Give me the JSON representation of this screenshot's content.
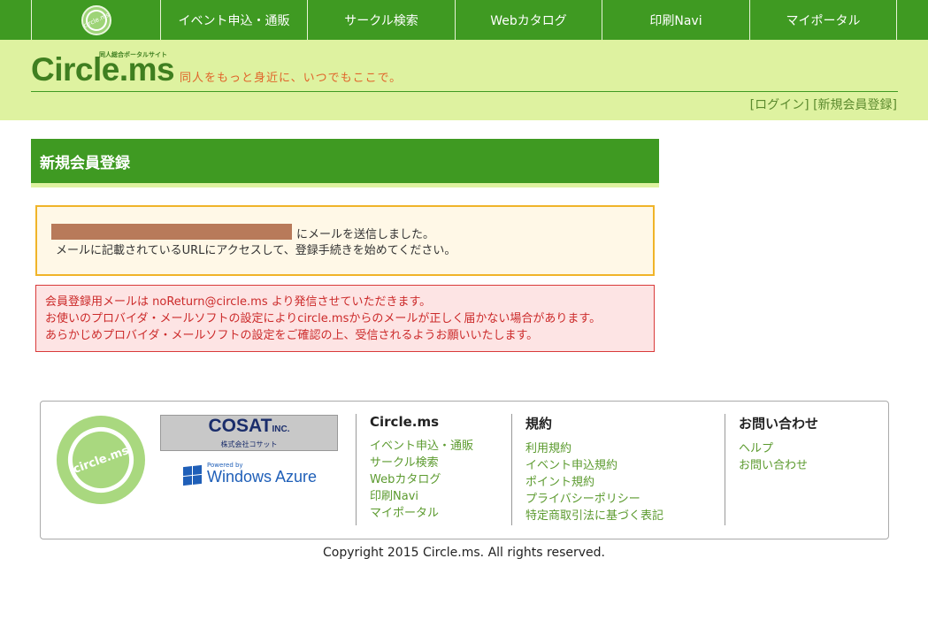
{
  "topnav": {
    "logo_text": "circle.ms",
    "items": [
      "イベント申込・通販",
      "サークル検索",
      "Webカタログ",
      "印刷Navi",
      "マイポータル"
    ]
  },
  "header": {
    "brand": "Circle.ms",
    "brand_sub": "同人総合ポータルサイト",
    "tagline": "同人をもっと身近に、いつでもここで。",
    "login": "[ログイン]",
    "register": "[新規会員登録]"
  },
  "page": {
    "title": "新規会員登録"
  },
  "notice": {
    "line1": "にメールを送信しました。",
    "line2": "メールに記載されているURLにアクセスして、登録手続きを始めてください。"
  },
  "warning": {
    "line1": "会員登録用メールは noReturn@circle.ms より発信させていただきます。",
    "line2": "お使いのプロバイダ・メールソフトの設定によりcircle.msからのメールが正しく届かない場合があります。",
    "line3": "あらかじめプロバイダ・メールソフトの設定をご確認の上、受信されるようお願いいたします。"
  },
  "footer": {
    "logo_text": "circle.ms",
    "cosat_main": "COSAT",
    "cosat_inc": "INC.",
    "cosat_sub": "株式会社コサット",
    "azure_powered": "Powered by",
    "azure_name": "Windows Azure",
    "columns": [
      {
        "title": "Circle.ms",
        "links": [
          "イベント申込・通販",
          "サークル検索",
          "Webカタログ",
          "印刷Navi",
          "マイポータル"
        ]
      },
      {
        "title": "規約",
        "links": [
          "利用規約",
          "イベント申込規約",
          "ポイント規約",
          "プライバシーポリシー",
          "特定商取引法に基づく表記"
        ]
      },
      {
        "title": "お問い合わせ",
        "links": [
          "ヘルプ",
          "お問い合わせ"
        ]
      }
    ],
    "copyright": "Copyright 2015 Circle.ms. All rights reserved."
  },
  "colors": {
    "nav_green": "#3f9a22",
    "header_bg": "#def2a0",
    "notice_border": "#f0b429",
    "warning_text": "#cc2a2a"
  }
}
